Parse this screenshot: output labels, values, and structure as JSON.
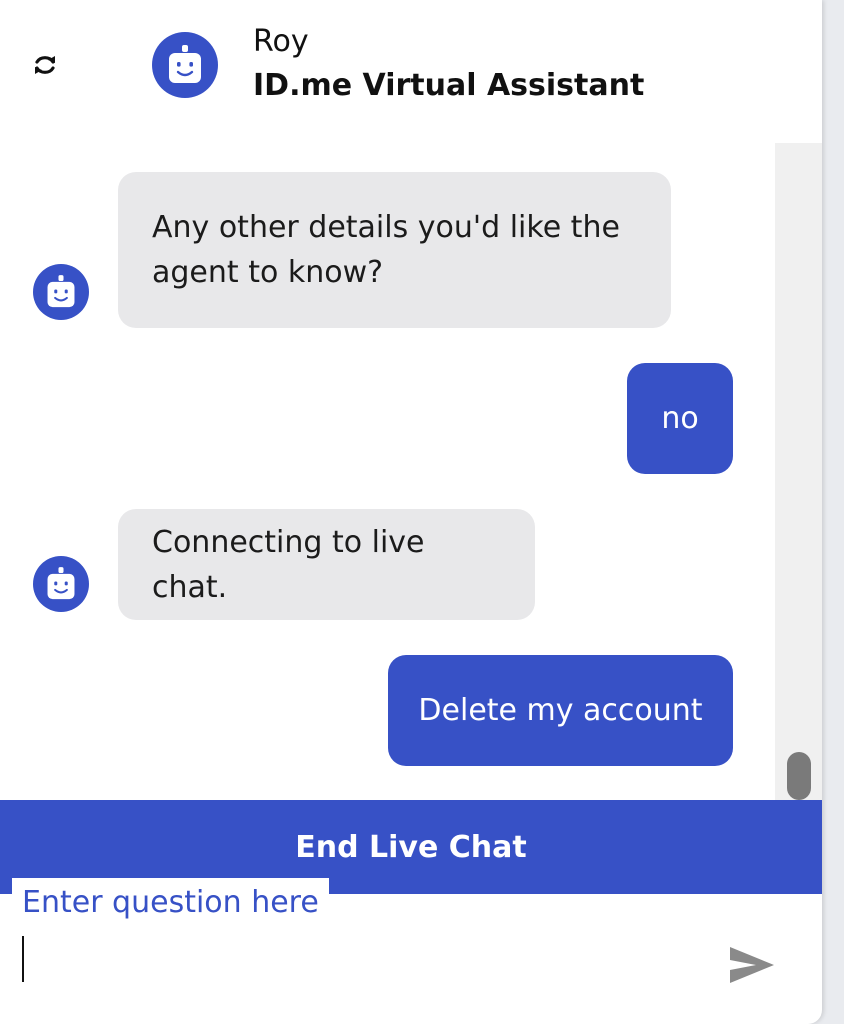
{
  "header": {
    "refresh_icon": "refresh-icon",
    "avatar_icon": "robot-icon",
    "name": "Roy",
    "subtitle": "ID.me Virtual Assistant"
  },
  "messages": [
    {
      "from": "bot",
      "text": "Any other details you'd like the agent to know?"
    },
    {
      "from": "user",
      "text": "no"
    },
    {
      "from": "bot",
      "text": "Connecting to live chat."
    },
    {
      "from": "user",
      "text": "Delete my account"
    }
  ],
  "end_chat_label": "End Live Chat",
  "input": {
    "label": "Enter question here",
    "value": ""
  },
  "send_icon": "send-icon",
  "colors": {
    "accent": "#3751c6",
    "bot_bubble": "#e8e8ea",
    "user_bubble": "#3751c6",
    "text": "#1b1b1b"
  }
}
